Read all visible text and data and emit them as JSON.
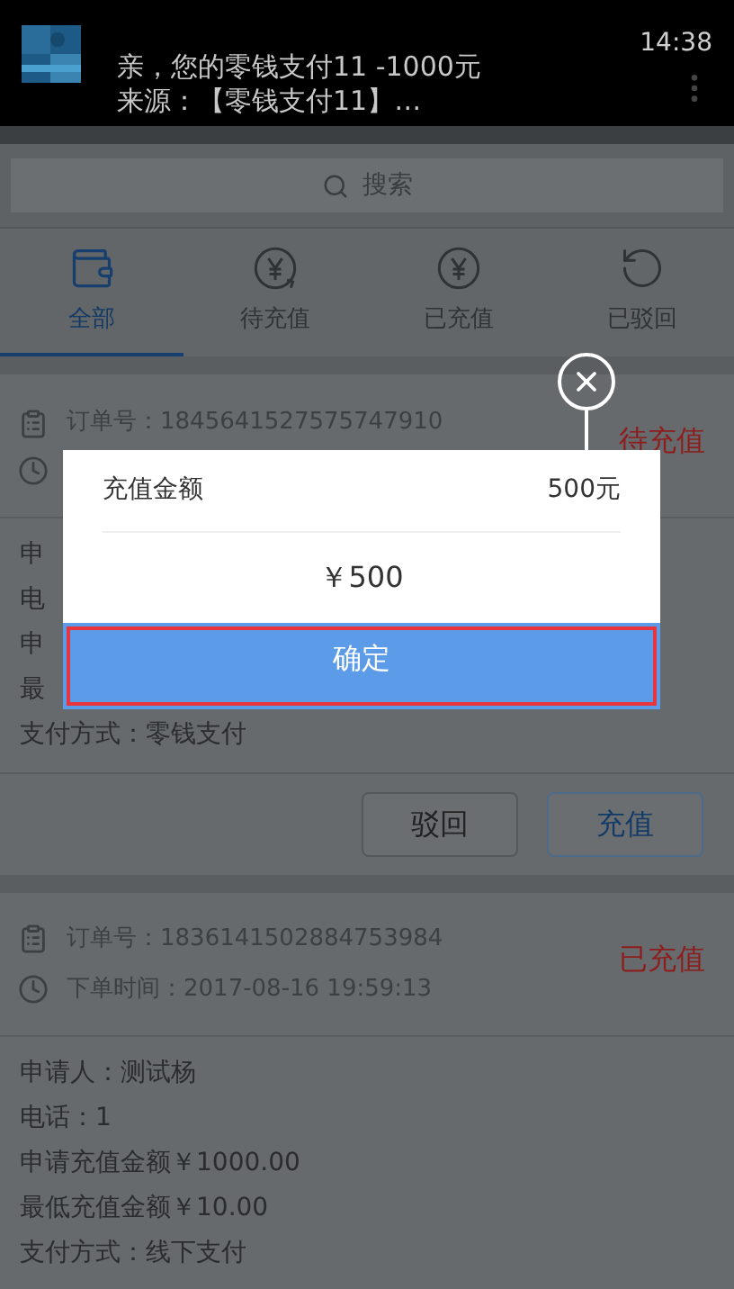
{
  "notification": {
    "time": "14:38",
    "lines": [
      "亲，您的零钱支付11 -1000元",
      "来源：【零钱支付11】…"
    ]
  },
  "search": {
    "placeholder": "搜索"
  },
  "tabs": [
    {
      "label": "全部",
      "kind": "wallet",
      "selected": true
    },
    {
      "label": "待充值",
      "kind": "pending",
      "selected": false
    },
    {
      "label": "已充值",
      "kind": "yen",
      "selected": false
    },
    {
      "label": "已驳回",
      "kind": "undo",
      "selected": false
    }
  ],
  "orders": [
    {
      "order_no": "订单号：1845641527575747910",
      "status": "待充值",
      "details": [
        "申",
        "电",
        "申",
        "最",
        "支付方式：零钱支付"
      ],
      "actions": [
        {
          "label": "驳回",
          "kind": "default"
        },
        {
          "label": "充值",
          "kind": "primary"
        }
      ]
    },
    {
      "order_no": "订单号：1836141502884753984",
      "order_time": "下单时间：2017-08-16 19:59:13",
      "status": "已充值",
      "details": [
        "申请人：测试杨",
        "电话：1",
        "申请充值金额￥1000.00",
        "最低充值金额￥10.00",
        "支付方式：线下支付"
      ]
    }
  ],
  "dialog": {
    "label": "充值金额",
    "value": "500元",
    "amount": "￥500",
    "confirm": "确定"
  }
}
